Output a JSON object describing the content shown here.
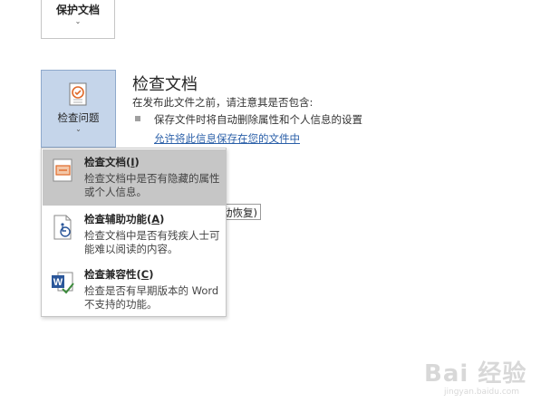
{
  "protect_tile": {
    "label": "保护文档",
    "chevron": "⌄"
  },
  "inspect_tile": {
    "label": "检查问题",
    "chevron": "⌄",
    "icon": "inspect-document-icon"
  },
  "section": {
    "title": "检查文档",
    "description": "在发布此文件之前，请注意其是否包含:",
    "bullet": "保存文件时将自动删除属性和个人信息的设置",
    "link": "允许将此信息保存在您的文件中"
  },
  "behind_button": {
    "label": "动恢复)"
  },
  "menu": {
    "items": [
      {
        "title_main": "检查文档(",
        "title_key": "I",
        "title_end": ")",
        "desc": "检查文档中是否有隐藏的属性或个人信息。",
        "icon": "inspect-document-icon",
        "highlighted": true
      },
      {
        "title_main": "检查辅助功能(",
        "title_key": "A",
        "title_end": ")",
        "desc": "检查文档中是否有残疾人士可能难以阅读的内容。",
        "icon": "accessibility-checker-icon",
        "highlighted": false
      },
      {
        "title_main": "检查兼容性(",
        "title_key": "C",
        "title_end": ")",
        "desc": "检查是否有早期版本的 Word 不支持的功能。",
        "icon": "word-compatibility-icon",
        "highlighted": false
      }
    ]
  },
  "watermark": {
    "text": "Bai 经验",
    "sub": "jingyan.baidu.com"
  },
  "colors": {
    "active_tile": "#c5d5ea",
    "menu_highlight": "#c6c6c6",
    "link": "#2a5fa8",
    "word_blue": "#2b579a",
    "check_green": "#3c8a3c",
    "inspect_orange": "#e06a2a"
  }
}
